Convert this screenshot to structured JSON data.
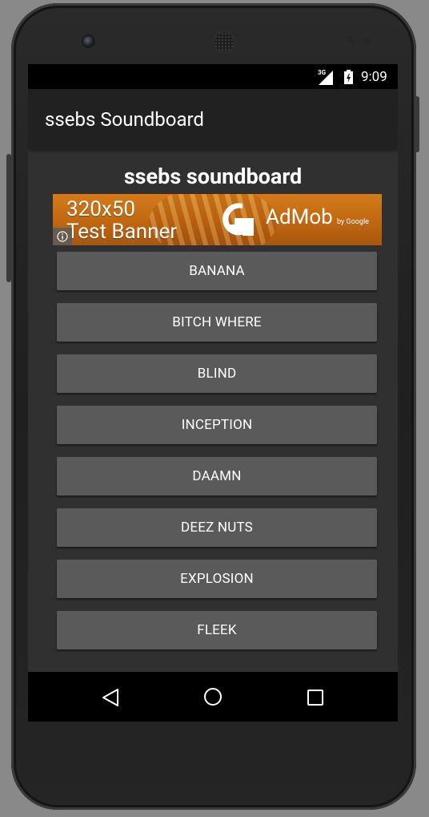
{
  "status_bar": {
    "network": "3G",
    "time": "9:09",
    "icons": [
      "signal-icon",
      "battery-icon"
    ]
  },
  "app_bar": {
    "title": "ssebs Soundboard"
  },
  "content": {
    "heading": "ssebs soundboard"
  },
  "ad_banner": {
    "line1": "320x50",
    "line2": "Test Banner",
    "brand": "AdMob",
    "brand_by": "by Google",
    "info_icon": "info-icon"
  },
  "sound_buttons": [
    {
      "label": "BANANA"
    },
    {
      "label": "BITCH WHERE"
    },
    {
      "label": "BLIND"
    },
    {
      "label": "INCEPTION"
    },
    {
      "label": "DAAMN"
    },
    {
      "label": "DEEZ NUTS"
    },
    {
      "label": "EXPLOSION"
    },
    {
      "label": "FLEEK"
    }
  ],
  "nav_bar": {
    "icons": [
      "back-icon",
      "home-icon",
      "recents-icon"
    ]
  },
  "colors": {
    "screen_bg": "#303030",
    "app_bar_bg": "#212121",
    "button_bg": "#5a5a5a",
    "ad_orange": "#c46a12",
    "device_body": "#1f1f1f",
    "backdrop": "#898989"
  }
}
